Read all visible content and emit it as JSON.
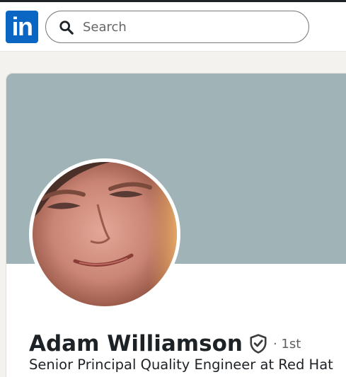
{
  "header": {
    "logo_text": "in",
    "search": {
      "placeholder": "Search",
      "value": ""
    }
  },
  "profile": {
    "name": "Adam Williamson",
    "degree": "· 1st",
    "headline": "Senior Principal Quality Engineer at Red Hat"
  },
  "icons": {
    "logo": "linkedin-logo",
    "search": "search-icon",
    "verified": "shield-check-icon"
  },
  "colors": {
    "brand": "#0a66c2",
    "banner": "#a0b4b7",
    "page_background": "#f3f2ef",
    "text_primary": "#1d2226"
  }
}
